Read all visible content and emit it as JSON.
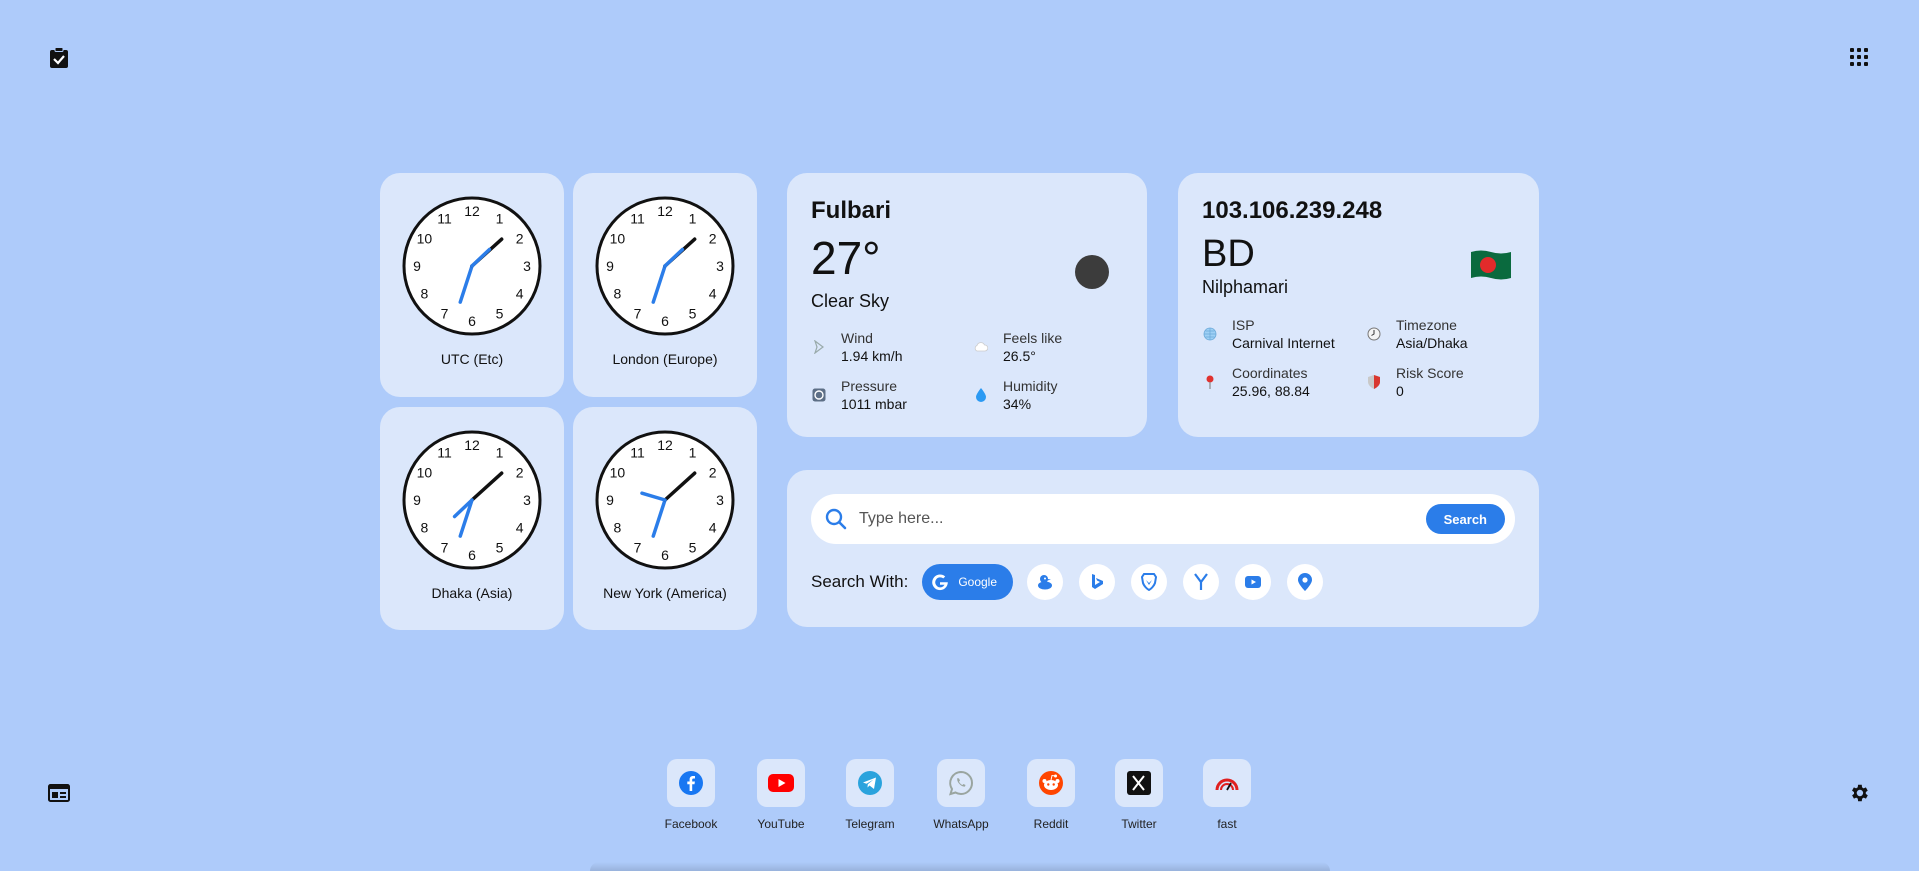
{
  "colors": {
    "background": "#aecbfa",
    "card": "#dbe7fb",
    "accent": "#2b7de9"
  },
  "corners": {
    "todo_icon": "clipboard-check-icon",
    "apps_icon": "apps-grid-icon",
    "news_icon": "newspaper-icon",
    "settings_icon": "gear-icon"
  },
  "clocks": [
    {
      "label": "UTC (Etc)",
      "hour": 1,
      "minute": 33
    },
    {
      "label": "London (Europe)",
      "hour": 1,
      "minute": 33
    },
    {
      "label": "Dhaka (Asia)",
      "hour": 7,
      "minute": 33
    },
    {
      "label": "New York (America)",
      "hour": 9,
      "minute": 33
    }
  ],
  "weather": {
    "city": "Fulbari",
    "temp": "27°",
    "condition": "Clear Sky",
    "wind_label": "Wind",
    "wind_value": "1.94 km/h",
    "feels_label": "Feels like",
    "feels_value": "26.5°",
    "pressure_label": "Pressure",
    "pressure_value": "1011 mbar",
    "humidity_label": "Humidity",
    "humidity_value": "34%"
  },
  "ip": {
    "address": "103.106.239.248",
    "country": "BD",
    "region": "Nilphamari",
    "isp_label": "ISP",
    "isp_value": "Carnival Internet",
    "timezone_label": "Timezone",
    "timezone_value": "Asia/Dhaka",
    "coords_label": "Coordinates",
    "coords_value": "25.96, 88.84",
    "risk_label": "Risk Score",
    "risk_value": "0"
  },
  "search": {
    "placeholder": "Type here...",
    "button": "Search",
    "with_label": "Search With:",
    "selected_engine": "Google",
    "engines": [
      "duckduckgo-icon",
      "bing-icon",
      "brave-icon",
      "yahoo-icon",
      "youtube-icon",
      "maps-icon"
    ]
  },
  "shortcuts": [
    {
      "label": "Facebook",
      "icon": "facebook-icon"
    },
    {
      "label": "YouTube",
      "icon": "youtube-icon"
    },
    {
      "label": "Telegram",
      "icon": "telegram-icon"
    },
    {
      "label": "WhatsApp",
      "icon": "whatsapp-icon"
    },
    {
      "label": "Reddit",
      "icon": "reddit-icon"
    },
    {
      "label": "Twitter",
      "icon": "x-twitter-icon"
    },
    {
      "label": "fast",
      "icon": "speedometer-icon"
    }
  ]
}
